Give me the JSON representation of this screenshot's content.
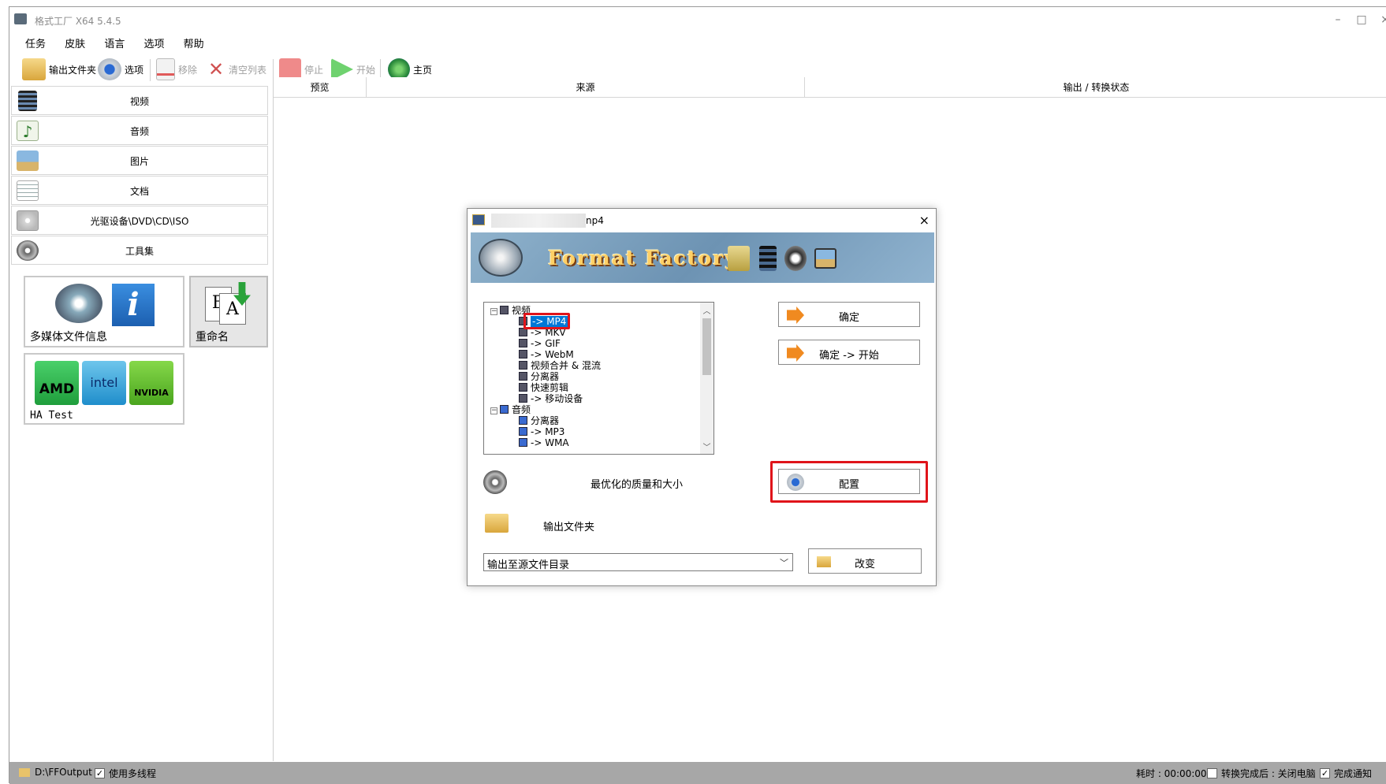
{
  "window": {
    "title": "格式工厂 X64 5.4.5",
    "controls": [
      "–",
      "□",
      "×"
    ]
  },
  "menu": [
    "任务",
    "皮肤",
    "语言",
    "选项",
    "帮助"
  ],
  "toolbar": {
    "output_folder": "输出文件夹",
    "options": "选项",
    "remove": "移除",
    "clear_list": "清空列表",
    "stop": "停止",
    "start": "开始",
    "home": "主页"
  },
  "sidebar": {
    "categories": [
      {
        "label": "视频",
        "icon": "film-icon"
      },
      {
        "label": "音频",
        "icon": "music-note-icon"
      },
      {
        "label": "图片",
        "icon": "picture-icon"
      },
      {
        "label": "文档",
        "icon": "document-icon"
      },
      {
        "label": "光驱设备\\DVD\\CD\\ISO",
        "icon": "disc-icon"
      },
      {
        "label": "工具集",
        "icon": "tools-reel-icon"
      }
    ],
    "tools": {
      "media_info": "多媒体文件信息",
      "rename": "重命名",
      "ha_test": "HA Test",
      "brands": [
        "AMD",
        "intel",
        "NVIDIA"
      ]
    }
  },
  "table": {
    "columns": [
      "预览",
      "来源",
      "输出 / 转换状态"
    ]
  },
  "statusbar": {
    "path": "D:\\FFOutput",
    "multithread": "使用多线程",
    "time_label": "耗时 : 00:00:00",
    "after_convert": "转换完成后 : 关闭电脑",
    "notify": "完成通知"
  },
  "dialog": {
    "title": "np4",
    "banner_text": "Format Factory",
    "tree": [
      {
        "label": "视频",
        "level": 0,
        "expander": "⊟"
      },
      {
        "label": "-> MP4",
        "level": 1,
        "selected": true
      },
      {
        "label": "-> MKV",
        "level": 1
      },
      {
        "label": "-> GIF",
        "level": 1
      },
      {
        "label": "-> WebM",
        "level": 1
      },
      {
        "label": "视频合并 & 混流",
        "level": 1
      },
      {
        "label": "分离器",
        "level": 1
      },
      {
        "label": "快速剪辑",
        "level": 1
      },
      {
        "label": "-> 移动设备",
        "level": 1
      },
      {
        "label": "音频",
        "level": 0,
        "expander": "⊟"
      },
      {
        "label": "分离器",
        "level": 1
      },
      {
        "label": "-> MP3",
        "level": 1
      },
      {
        "label": "-> WMA",
        "level": 1
      }
    ],
    "ok": "确定",
    "ok_start": "确定 -> 开始",
    "quality": "最优化的质量和大小",
    "config": "配置",
    "output_folder": "输出文件夹",
    "output_select": "输出至源文件目录",
    "change": "改变"
  },
  "colors": {
    "highlight": "#e0141a",
    "selection": "#0078d7",
    "statusbar": "#a7a7a7"
  }
}
